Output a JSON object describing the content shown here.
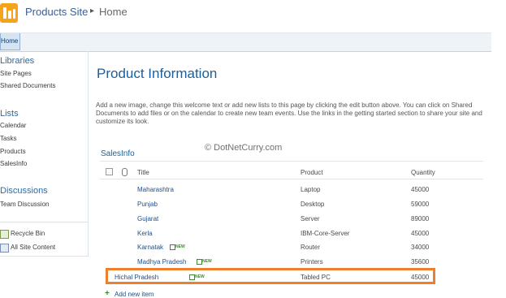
{
  "header": {
    "site_title": "Products Site",
    "separator": "▸",
    "current_page": "Home"
  },
  "nav": {
    "home_tab": "Home"
  },
  "quicklaunch": {
    "libraries_heading": "Libraries",
    "libraries": [
      "Site Pages",
      "Shared Documents"
    ],
    "lists_heading": "Lists",
    "lists": [
      "Calendar",
      "Tasks",
      "Products",
      "SalesInfo"
    ],
    "discussions_heading": "Discussions",
    "discussions": [
      "Team Discussion"
    ],
    "recycle_bin": "Recycle Bin",
    "all_site_content": "All Site Content"
  },
  "main": {
    "title": "Product Information",
    "welcome_text": "Add a new image, change this welcome text or add new lists to this page by clicking the edit button above. You can click on Shared Documents to add files or on the calendar to create new team events. Use the links in the getting started section to share your site and customize its look.",
    "watermark": "© DotNetCurry.com"
  },
  "list": {
    "title": "SalesInfo",
    "columns": {
      "title": "Title",
      "product": "Product",
      "quantity": "Quantity"
    },
    "new_label": "NEW",
    "rows": [
      {
        "title": "Maharashtra",
        "product": "Laptop",
        "quantity": "45000",
        "is_new": false
      },
      {
        "title": "Punjab",
        "product": "Desktop",
        "quantity": "59000",
        "is_new": false
      },
      {
        "title": "Gujarat",
        "product": "Server",
        "quantity": "89000",
        "is_new": false
      },
      {
        "title": "Kerla",
        "product": "IBM-Core-Server",
        "quantity": "45000",
        "is_new": false
      },
      {
        "title": "Karnatak",
        "product": "Router",
        "quantity": "34000",
        "is_new": true
      },
      {
        "title": "Madhya Pradesh",
        "product": "Printers",
        "quantity": "35600",
        "is_new": true
      },
      {
        "title": "Hichal Pradesh",
        "product": "Tabled PC",
        "quantity": "45000",
        "is_new": true
      }
    ],
    "add_new_item": "Add new item"
  },
  "colors": {
    "accent": "#1a5f99",
    "highlight_border": "#ee7d2c",
    "new_badge": "#3c8a2e",
    "logo": "#f4a31a"
  }
}
